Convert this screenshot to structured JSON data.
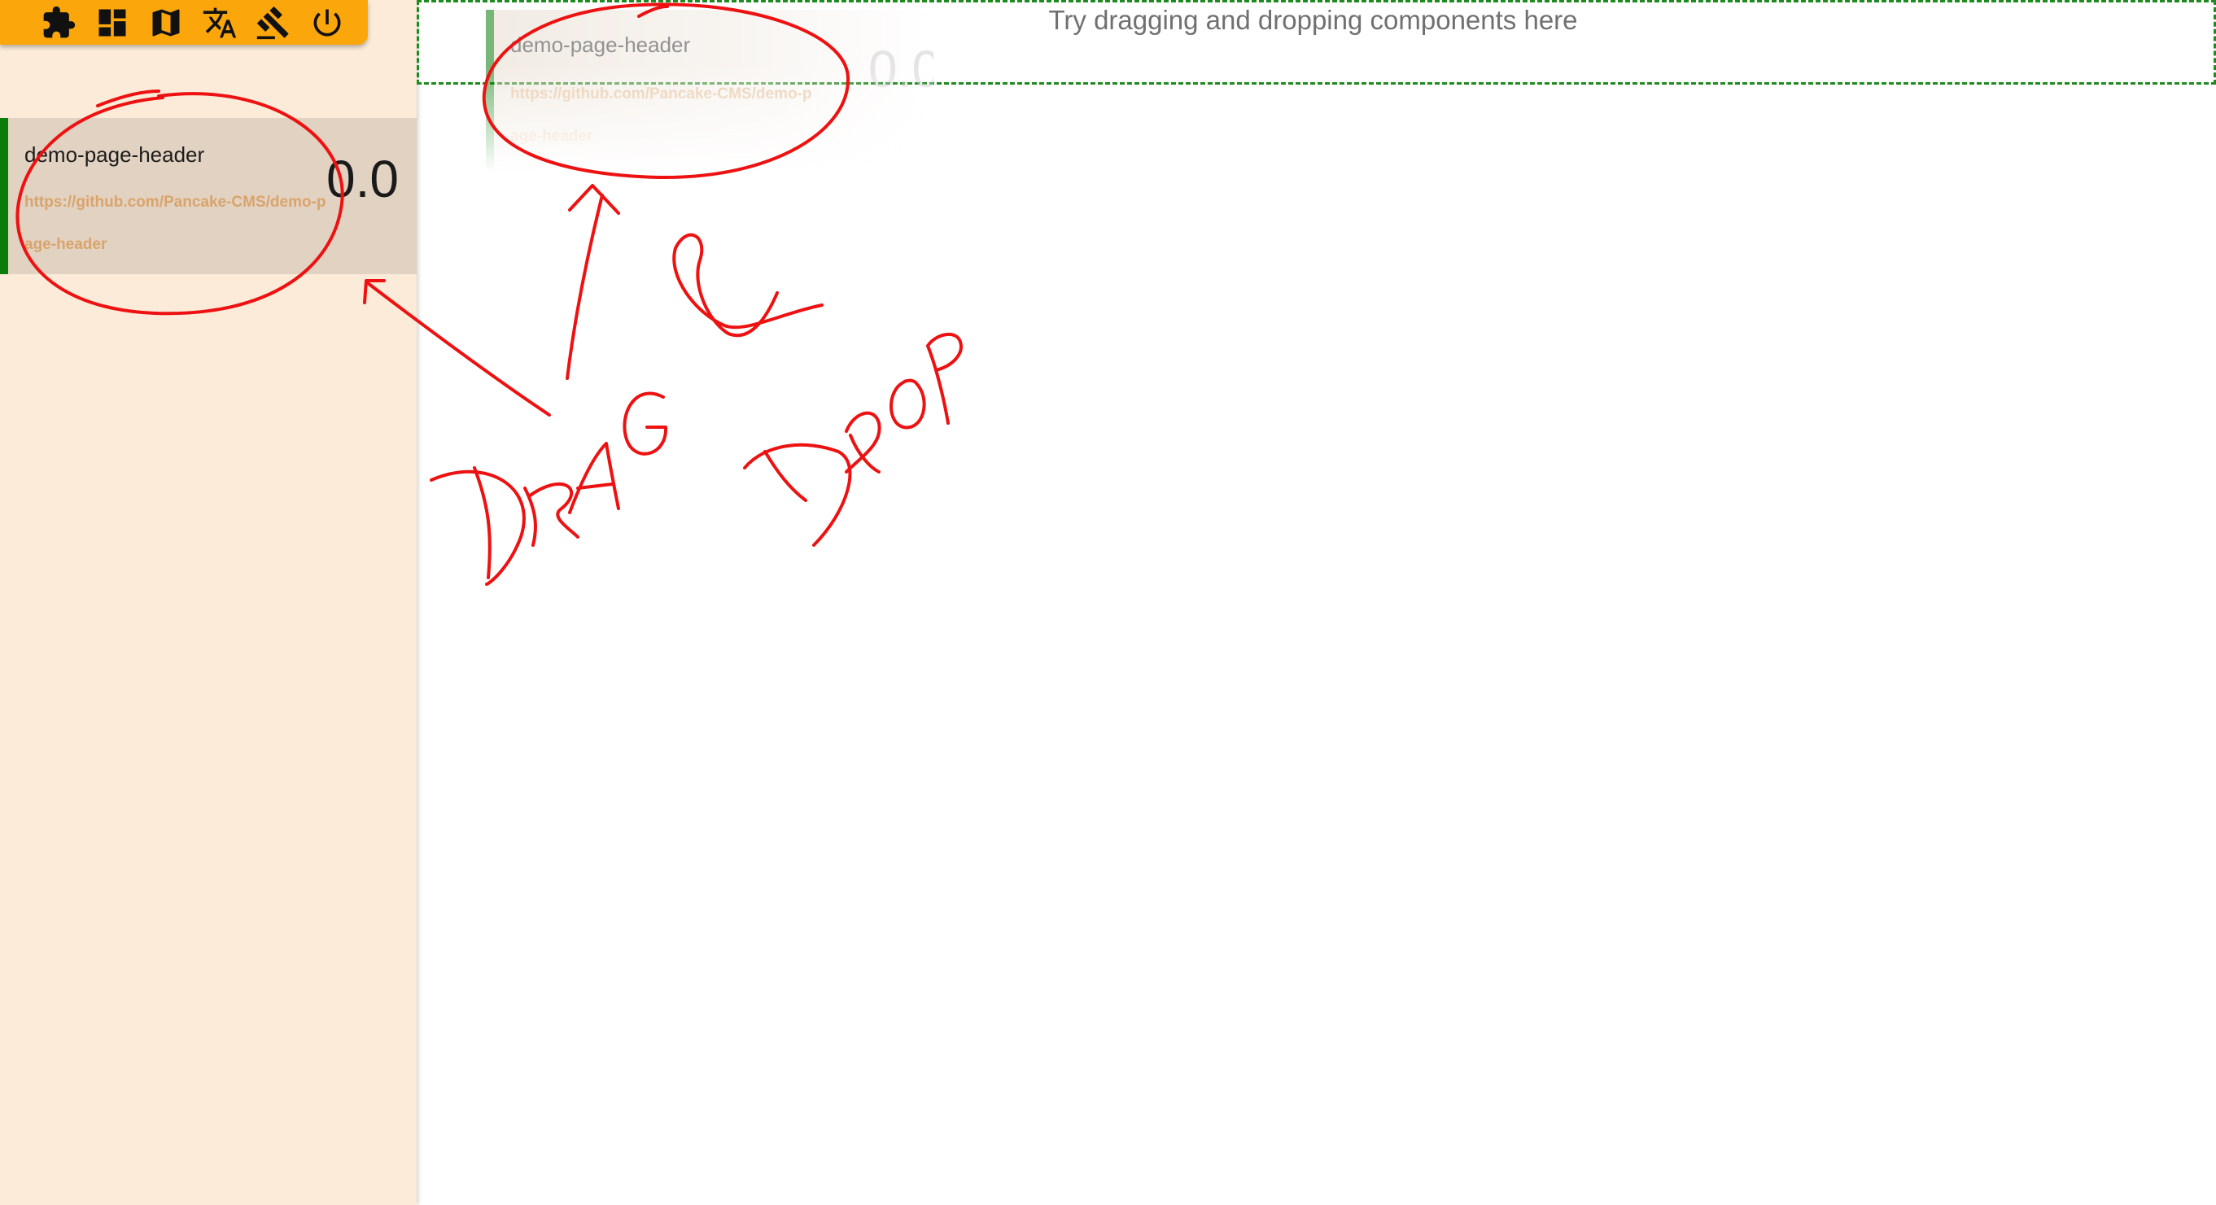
{
  "toolbar": {
    "buttons": [
      {
        "icon": "puzzle-icon"
      },
      {
        "icon": "dashboard-icon"
      },
      {
        "icon": "map-icon"
      },
      {
        "icon": "translate-icon"
      },
      {
        "icon": "gavel-icon"
      },
      {
        "icon": "power-icon"
      }
    ],
    "background_color": "#fba70c"
  },
  "sidebar": {
    "background_color": "#fbebd8",
    "components": [
      {
        "name": "demo-page-header",
        "url": "https://github.com/Pancake-CMS/demo-page-header",
        "version": "0.0",
        "accent_color": "#0a7c0a"
      }
    ]
  },
  "main": {
    "drop_hint": "Try dragging and dropping components here",
    "drop_zone_border_color": "#1d8a1d",
    "drag_ghost": {
      "name": "demo-page-header",
      "url": "https://github.com/Pancake-CMS/demo-page-header",
      "version": "0.0"
    }
  },
  "annotation": {
    "color": "#ee1111",
    "words": [
      "DRAG",
      "&",
      "DROP"
    ]
  }
}
